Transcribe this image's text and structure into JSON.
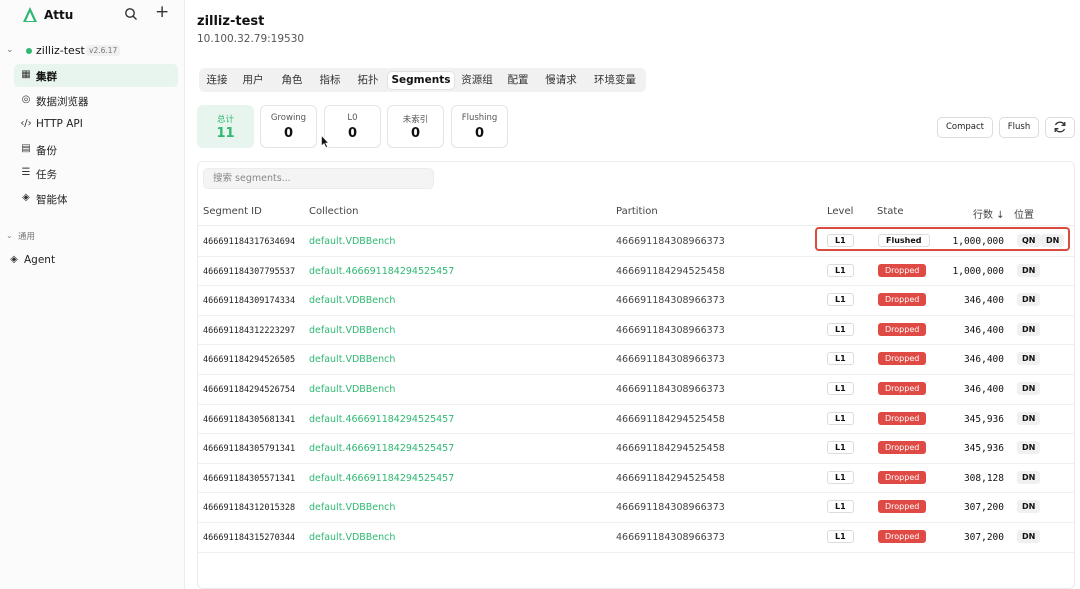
{
  "app": {
    "name": "Attu"
  },
  "connection": {
    "name": "zilliz-test",
    "version": "v2.6.17"
  },
  "sidebar": {
    "items": [
      {
        "label": "集群",
        "icon": "grid-icon"
      },
      {
        "label": "数据浏览器",
        "icon": "compass-icon"
      },
      {
        "label": "HTTP API",
        "icon": "code-icon"
      },
      {
        "label": "备份",
        "icon": "backup-icon"
      },
      {
        "label": "任务",
        "icon": "tasks-icon"
      },
      {
        "label": "智能体",
        "icon": "robot-icon"
      }
    ],
    "section_label": "通用",
    "agent_label": "Agent"
  },
  "header": {
    "title": "zilliz-test",
    "address": "10.100.32.79:19530"
  },
  "tabs": [
    "连接",
    "用户",
    "角色",
    "指标",
    "拓扑",
    "Segments",
    "资源组",
    "配置",
    "慢请求",
    "环境变量"
  ],
  "active_tab": "Segments",
  "stats": [
    {
      "label": "总计",
      "value": "11"
    },
    {
      "label": "Growing",
      "value": "0"
    },
    {
      "label": "L0",
      "value": "0"
    },
    {
      "label": "未索引",
      "value": "0"
    },
    {
      "label": "Flushing",
      "value": "0"
    }
  ],
  "actions": {
    "compact": "Compact",
    "flush": "Flush"
  },
  "search": {
    "placeholder": "搜索 segments..."
  },
  "table": {
    "headers": {
      "segment_id": "Segment ID",
      "collection": "Collection",
      "partition": "Partition",
      "level": "Level",
      "state": "State",
      "rows": "行数 ↓",
      "position": "位置"
    },
    "rows": [
      {
        "id": "466691184317634694",
        "collection": "default.VDBBench",
        "partition": "466691184308966373",
        "level": "L1",
        "state": "Flushed",
        "rows": "1,000,000",
        "position": [
          "QN",
          "DN"
        ]
      },
      {
        "id": "466691184307795537",
        "collection": "default.466691184294525457",
        "partition": "466691184294525458",
        "level": "L1",
        "state": "Dropped",
        "rows": "1,000,000",
        "position": [
          "DN"
        ]
      },
      {
        "id": "466691184309174334",
        "collection": "default.VDBBench",
        "partition": "466691184308966373",
        "level": "L1",
        "state": "Dropped",
        "rows": "346,400",
        "position": [
          "DN"
        ]
      },
      {
        "id": "466691184312223297",
        "collection": "default.VDBBench",
        "partition": "466691184308966373",
        "level": "L1",
        "state": "Dropped",
        "rows": "346,400",
        "position": [
          "DN"
        ]
      },
      {
        "id": "466691184294526505",
        "collection": "default.VDBBench",
        "partition": "466691184308966373",
        "level": "L1",
        "state": "Dropped",
        "rows": "346,400",
        "position": [
          "DN"
        ]
      },
      {
        "id": "466691184294526754",
        "collection": "default.VDBBench",
        "partition": "466691184308966373",
        "level": "L1",
        "state": "Dropped",
        "rows": "346,400",
        "position": [
          "DN"
        ]
      },
      {
        "id": "466691184305681341",
        "collection": "default.466691184294525457",
        "partition": "466691184294525458",
        "level": "L1",
        "state": "Dropped",
        "rows": "345,936",
        "position": [
          "DN"
        ]
      },
      {
        "id": "466691184305791341",
        "collection": "default.466691184294525457",
        "partition": "466691184294525458",
        "level": "L1",
        "state": "Dropped",
        "rows": "345,936",
        "position": [
          "DN"
        ]
      },
      {
        "id": "466691184305571341",
        "collection": "default.466691184294525457",
        "partition": "466691184294525458",
        "level": "L1",
        "state": "Dropped",
        "rows": "308,128",
        "position": [
          "DN"
        ]
      },
      {
        "id": "466691184312015328",
        "collection": "default.VDBBench",
        "partition": "466691184308966373",
        "level": "L1",
        "state": "Dropped",
        "rows": "307,200",
        "position": [
          "DN"
        ]
      },
      {
        "id": "466691184315270344",
        "collection": "default.VDBBench",
        "partition": "466691184308966373",
        "level": "L1",
        "state": "Dropped",
        "rows": "307,200",
        "position": [
          "DN"
        ]
      }
    ]
  },
  "colors": {
    "accent": "#2eb872",
    "dropped": "#e04a45",
    "highlight": "#d94a3f"
  }
}
